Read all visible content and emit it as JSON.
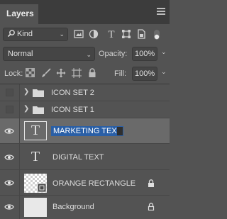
{
  "panel": {
    "tab_label": "Layers",
    "menu_icon": "hamburger-menu-icon"
  },
  "filter": {
    "kind_label": "Kind",
    "icons": [
      "pixel-filter-icon",
      "adjustment-filter-icon",
      "type-filter-icon",
      "shape-filter-icon",
      "smart-object-filter-icon"
    ]
  },
  "blend": {
    "mode": "Normal",
    "opacity_label": "Opacity:",
    "opacity_value": "100%"
  },
  "lock": {
    "label": "Lock:",
    "fill_label": "Fill:",
    "fill_value": "100%",
    "icons": [
      "lock-transparent-icon",
      "lock-image-icon",
      "lock-position-icon",
      "lock-artboard-icon",
      "lock-all-icon"
    ]
  },
  "layers": [
    {
      "name": "ICON SET 2",
      "type": "group",
      "visible": false
    },
    {
      "name": "ICON SET 1",
      "type": "group",
      "visible": false
    },
    {
      "name": "MARKETING TEXT",
      "type": "text",
      "visible": true,
      "selected": true,
      "editing": true
    },
    {
      "name": "DIGITAL TEXT",
      "type": "text",
      "visible": true
    },
    {
      "name": "ORANGE RECTANGLE",
      "type": "shape",
      "visible": true,
      "locked": true
    },
    {
      "name": "Background",
      "type": "pixel",
      "visible": true,
      "locked": true
    }
  ],
  "colors": {
    "panel_bg": "#535353",
    "selected_row": "#6a6a6a",
    "text_selection": "#2a5fa6"
  }
}
